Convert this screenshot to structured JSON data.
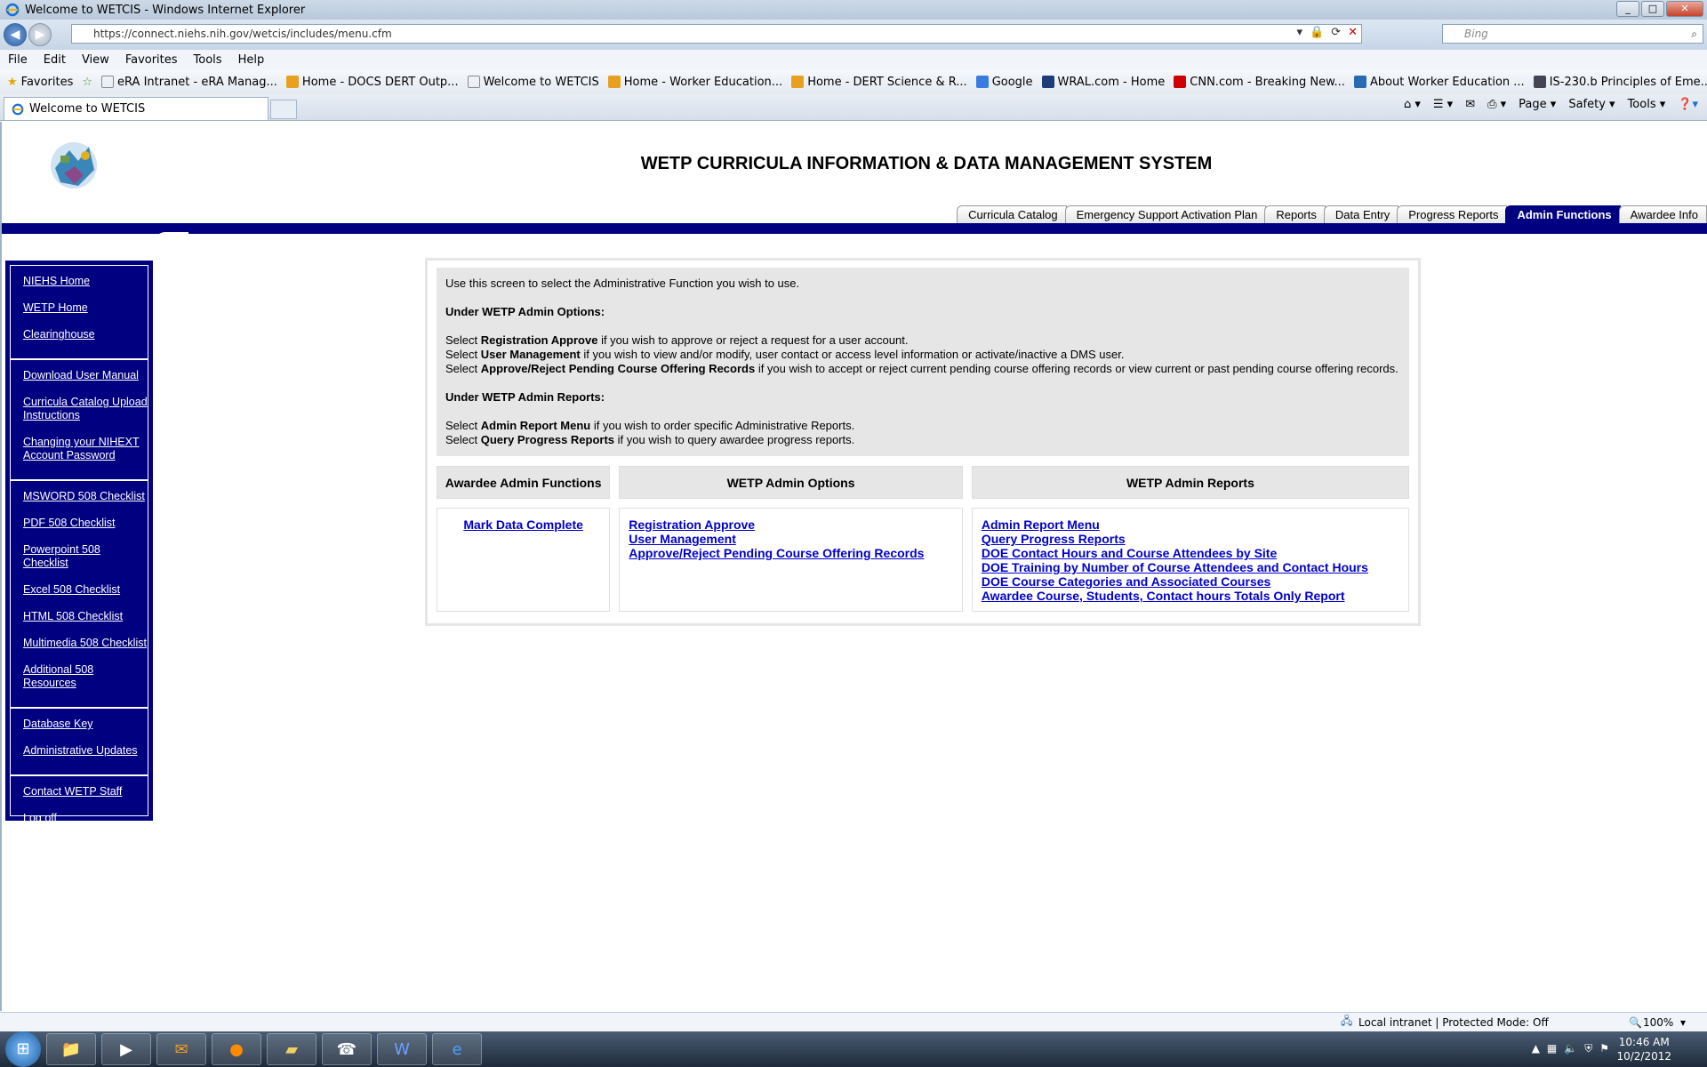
{
  "window": {
    "title": "Welcome to WETCIS - Windows Internet Explorer",
    "url": "https://connect.niehs.nih.gov/wetcis/includes/menu.cfm",
    "search_placeholder": "Bing",
    "tab_title": "Welcome to WETCIS"
  },
  "menubar": [
    "File",
    "Edit",
    "View",
    "Favorites",
    "Tools",
    "Help"
  ],
  "favorites_bar": {
    "label": "Favorites",
    "items": [
      "eRA Intranet - eRA Manag...",
      "Home - DOCS DERT Outp...",
      "Welcome to WETCIS",
      "Home - Worker Education...",
      "Home - DERT Science & R...",
      "Google",
      "WRAL.com - Home",
      "CNN.com - Breaking New...",
      "About Worker Education ...",
      "IS-230.b Principles of Eme..."
    ]
  },
  "command_bar": {
    "page": "Page",
    "safety": "Safety",
    "tools": "Tools"
  },
  "site": {
    "title": "WETP CURRICULA INFORMATION & DATA MANAGEMENT SYSTEM",
    "nav_tabs": [
      {
        "label": "Curricula Catalog",
        "active": false
      },
      {
        "label": "Emergency Support Activation Plan",
        "active": false
      },
      {
        "label": "Reports",
        "active": false
      },
      {
        "label": "Data Entry",
        "active": false
      },
      {
        "label": "Progress Reports",
        "active": false
      },
      {
        "label": "Admin Functions",
        "active": true
      },
      {
        "label": "Awardee Info",
        "active": false
      }
    ],
    "nav_active_color": "#000080"
  },
  "sidebar": {
    "groups": [
      [
        "NIEHS Home",
        "WETP Home",
        "Clearinghouse"
      ],
      [
        "Download User Manual",
        "Curricula Catalog Upload Instructions",
        "Changing your NIHEXT Account Password"
      ],
      [
        "MSWORD 508 Checklist",
        "PDF 508 Checklist",
        "Powerpoint 508 Checklist",
        "Excel 508 Checklist",
        "HTML 508 Checklist",
        "Multimedia 508 Checklist",
        "Additional 508 Resources"
      ],
      [
        "Database Key",
        "Administrative Updates"
      ],
      [
        "Contact WETP Staff",
        "Log off"
      ]
    ]
  },
  "intro": {
    "line1": "Use this screen to select the Administrative Function you wish to use.",
    "options_heading": "Under WETP Admin Options:",
    "options": [
      {
        "pre": "Select ",
        "bold": "Registration Approve",
        "post": " if you wish to approve or reject a request for a user account."
      },
      {
        "pre": "Select ",
        "bold": "User Management",
        "post": " if you wish to view and/or modify, user contact or access level information or activate/inactive a DMS user."
      },
      {
        "pre": "Select ",
        "bold": "Approve/Reject Pending Course Offering Records",
        "post": " if you wish to accept or reject current pending course offering records or view current or past pending course offering records."
      }
    ],
    "reports_heading": "Under WETP Admin Reports:",
    "reports": [
      {
        "pre": "Select ",
        "bold": "Admin Report Menu",
        "post": " if you wish to order specific Administrative Reports."
      },
      {
        "pre": "Select ",
        "bold": "Query Progress Reports",
        "post": " if you wish to query awardee progress reports."
      }
    ]
  },
  "columns": {
    "awardee": {
      "heading": "Awardee Admin Functions",
      "links": [
        "Mark Data Complete"
      ]
    },
    "options": {
      "heading": "WETP Admin Options",
      "links": [
        "Registration Approve",
        "User Management",
        "Approve/Reject Pending Course Offering Records"
      ]
    },
    "reports": {
      "heading": "WETP Admin Reports",
      "links": [
        "Admin Report Menu",
        "Query Progress Reports",
        "DOE Contact Hours and Course Attendees by Site",
        "DOE Training by Number of Course Attendees and Contact Hours",
        "DOE Course Categories and Associated Courses",
        "Awardee Course, Students, Contact hours Totals Only Report"
      ]
    }
  },
  "link_color": "#0000cc",
  "statusbar": {
    "zone": "Local intranet | Protected Mode: Off",
    "zoom": "100%"
  },
  "taskbar": {
    "time": "10:46 AM",
    "date": "10/2/2012"
  }
}
